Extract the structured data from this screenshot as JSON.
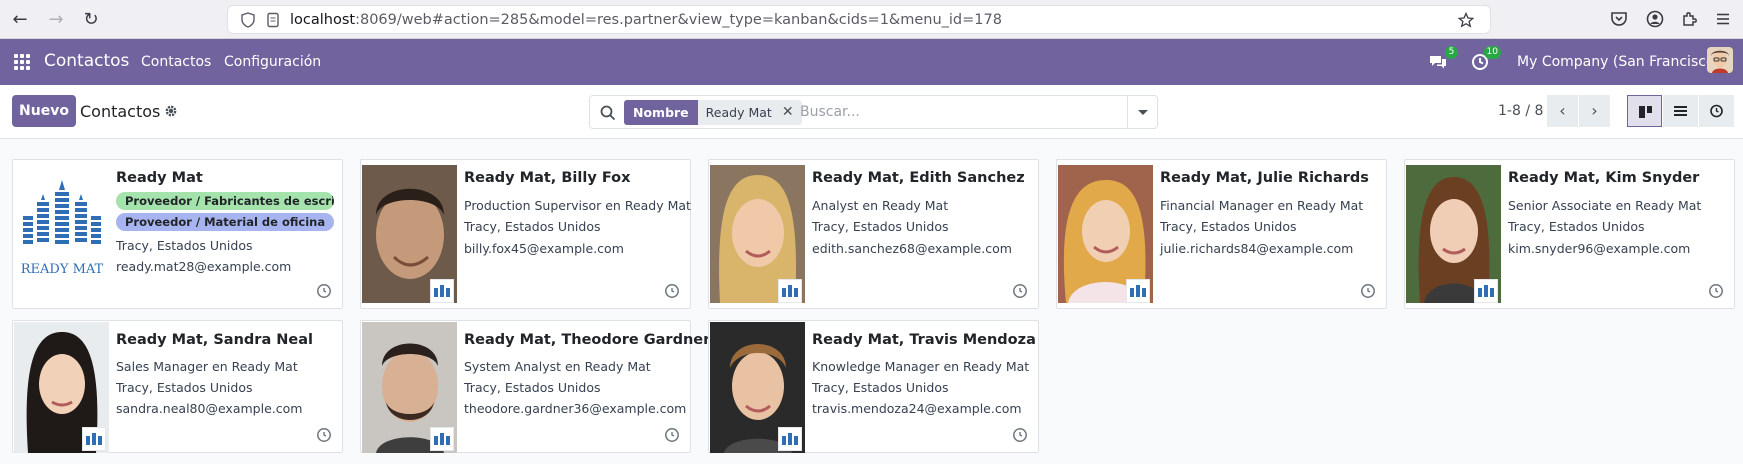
{
  "browser": {
    "url_host": "localhost",
    "url_rest": ":8069/web#action=285&model=res.partner&view_type=kanban&cids=1&menu_id=178"
  },
  "navbar": {
    "app_name": "Contactos",
    "menus": [
      "Contactos",
      "Configuración"
    ],
    "messages_badge": "5",
    "activities_badge": "10",
    "company": "My Company (San Francisco)"
  },
  "control_panel": {
    "new_label": "Nuevo",
    "title": "Contactos",
    "facet_label": "Nombre",
    "facet_value": "Ready Mat",
    "search_placeholder": "Buscar...",
    "pager": "1-8 / 8"
  },
  "colors": {
    "brand": "#71639e",
    "tag_green": "#a5e3ad",
    "tag_purple": "#a8b4ef"
  },
  "cards": [
    {
      "title": "Ready Mat",
      "tags": [
        "Proveedor / Fabricantes de escrit...",
        "Proveedor / Material de oficina"
      ],
      "lines": [
        "Tracy, Estados Unidos",
        "ready.mat28@example.com"
      ],
      "logo_text": "READY MAT"
    },
    {
      "title": "Ready Mat, Billy Fox",
      "lines": [
        "Production Supervisor en Ready Mat",
        "Tracy, Estados Unidos",
        "billy.fox45@example.com"
      ]
    },
    {
      "title": "Ready Mat, Edith Sanchez",
      "lines": [
        "Analyst en Ready Mat",
        "Tracy, Estados Unidos",
        "edith.sanchez68@example.com"
      ]
    },
    {
      "title": "Ready Mat, Julie Richards",
      "lines": [
        "Financial Manager en Ready Mat",
        "Tracy, Estados Unidos",
        "julie.richards84@example.com"
      ]
    },
    {
      "title": "Ready Mat, Kim Snyder",
      "lines": [
        "Senior Associate en Ready Mat",
        "Tracy, Estados Unidos",
        "kim.snyder96@example.com"
      ]
    },
    {
      "title": "Ready Mat, Sandra Neal",
      "lines": [
        "Sales Manager en Ready Mat",
        "Tracy, Estados Unidos",
        "sandra.neal80@example.com"
      ]
    },
    {
      "title": "Ready Mat, Theodore Gardner",
      "lines": [
        "System Analyst en Ready Mat",
        "Tracy, Estados Unidos",
        "theodore.gardner36@example.com"
      ]
    },
    {
      "title": "Ready Mat, Travis Mendoza",
      "lines": [
        "Knowledge Manager en Ready Mat",
        "Tracy, Estados Unidos",
        "travis.mendoza24@example.com"
      ]
    }
  ]
}
